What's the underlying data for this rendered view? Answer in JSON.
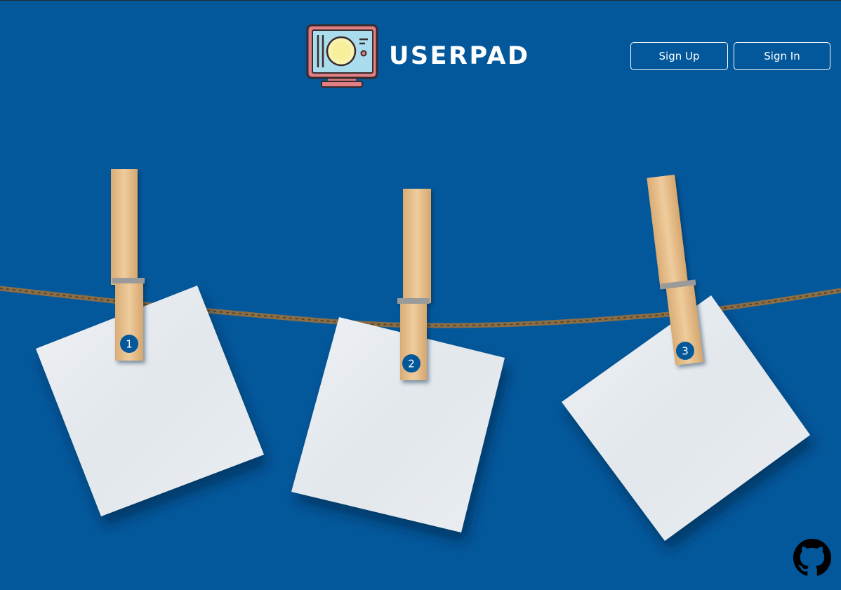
{
  "header": {
    "brand_name": "USERPAD",
    "sign_up_label": "Sign Up",
    "sign_in_label": "Sign In"
  },
  "notes": [
    {
      "number": "1"
    },
    {
      "number": "2"
    },
    {
      "number": "3"
    }
  ],
  "icons": {
    "logo": "monitor-logo-icon",
    "github": "github-icon"
  },
  "colors": {
    "background": "#03589b",
    "paper": "#e6eaee",
    "badge": "#03589b",
    "clothespin": "#e6bf8d",
    "rope": "#8a6e47"
  }
}
